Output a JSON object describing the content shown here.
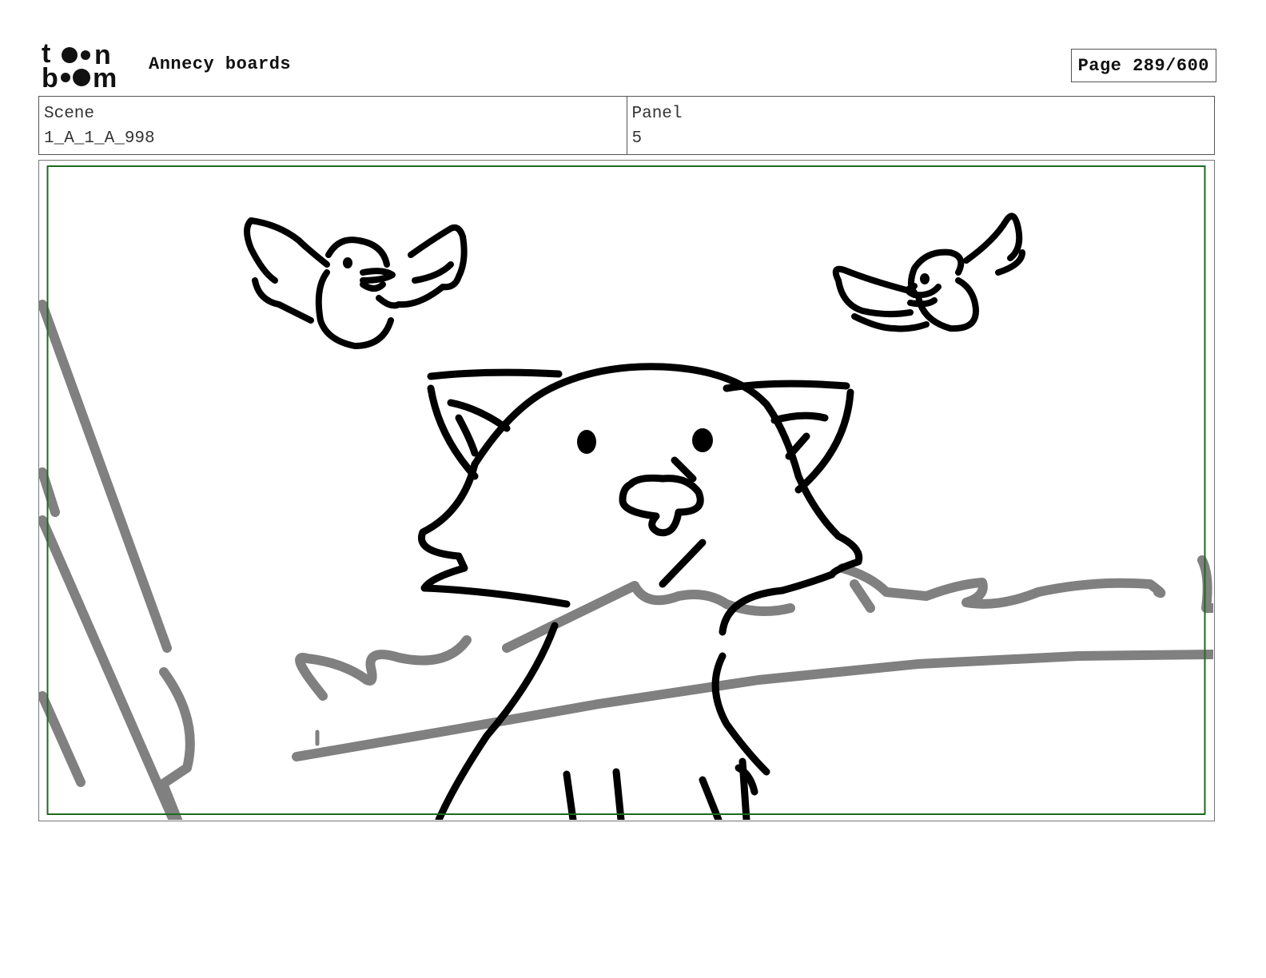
{
  "header": {
    "logo_text": "toon boom",
    "doc_title": "Annecy boards",
    "page_label": "Page 289/600"
  },
  "info": {
    "scene_label": "Scene",
    "scene_value": "1_A_1_A_998",
    "panel_label": "Panel",
    "panel_value": "5"
  },
  "panel_image": {
    "safe_frame_color": "#1e6b1e",
    "background_ink": "#808080",
    "foreground_ink": "#000000"
  }
}
